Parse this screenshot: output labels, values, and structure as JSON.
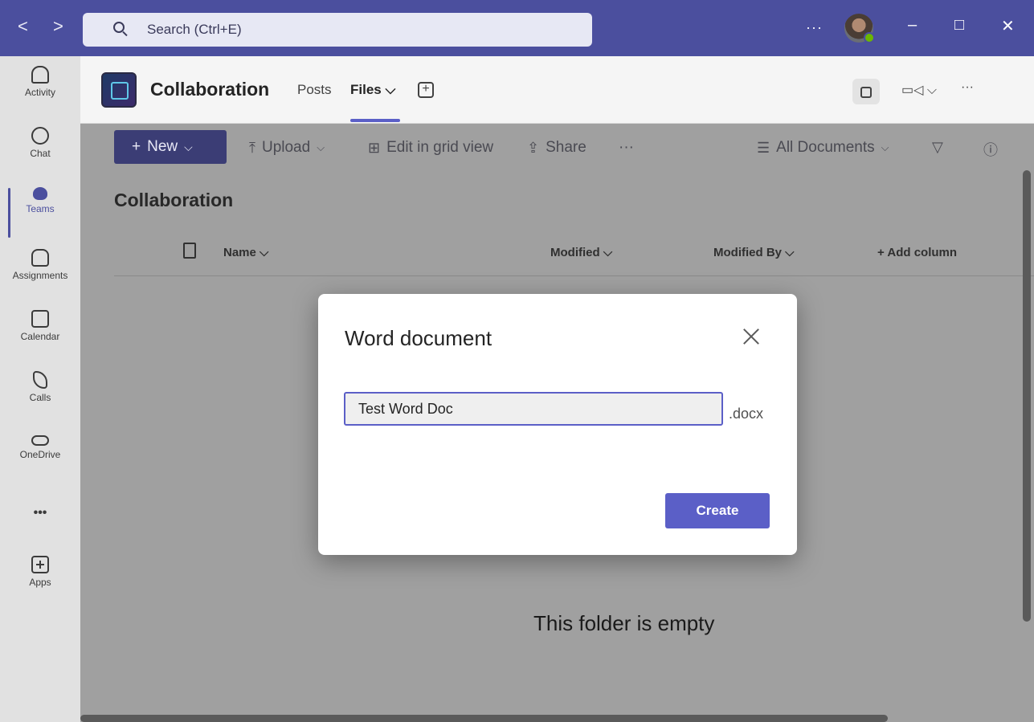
{
  "titlebar": {
    "back_glyph": "<",
    "forward_glyph": ">",
    "search_placeholder": "Search (Ctrl+E)",
    "more_glyph": "···",
    "minimize_glyph": "–",
    "maximize_glyph": "□",
    "close_glyph": "✕"
  },
  "rail": {
    "items": [
      {
        "label": "Activity",
        "icon": "bell-icon"
      },
      {
        "label": "Chat",
        "icon": "chat-icon"
      },
      {
        "label": "Teams",
        "icon": "teams-icon",
        "active": true
      },
      {
        "label": "Assignments",
        "icon": "backpack-icon"
      },
      {
        "label": "Calendar",
        "icon": "calendar-icon"
      },
      {
        "label": "Calls",
        "icon": "phone-icon"
      },
      {
        "label": "OneDrive",
        "icon": "cloud-icon"
      },
      {
        "label": "•••",
        "icon": "more-icon"
      },
      {
        "label": "Apps",
        "icon": "apps-icon"
      }
    ]
  },
  "channel": {
    "title": "Collaboration",
    "tabs": [
      {
        "label": "Posts"
      },
      {
        "label": "Files ⌵",
        "active": true
      }
    ],
    "video_glyph": "▭◁ ⌵",
    "more_glyph": "···"
  },
  "commandbar": {
    "new_label": "New",
    "upload_label": "Upload",
    "grid_label": "Edit in grid view",
    "share_label": "Share",
    "more_glyph": "···",
    "view_label": "All Documents"
  },
  "library": {
    "title": "Collaboration",
    "columns": [
      "Name ⌵",
      "Modified ⌵",
      "Modified By ⌵",
      "+ Add column"
    ],
    "empty_text": "This folder is empty"
  },
  "dialog": {
    "title": "Word document",
    "filename_value": "Test Word Doc",
    "extension": ".docx",
    "create_label": "Create"
  },
  "colors": {
    "titlebar_bg": "#4b4f9e",
    "accent": "#5b5fc7",
    "presence": "#6bb700"
  }
}
